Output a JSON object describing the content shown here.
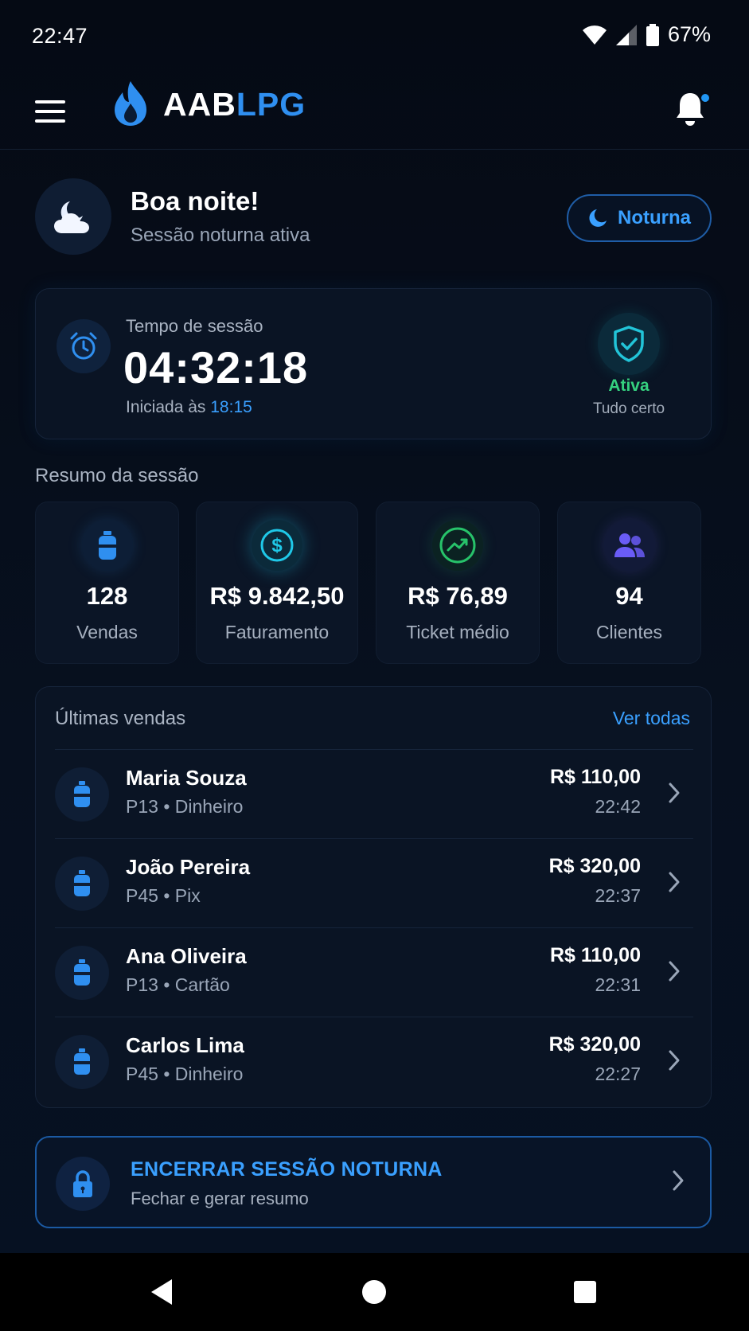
{
  "status_bar": {
    "time": "22:47",
    "battery": "67%"
  },
  "header": {
    "logo_part1": "AAB",
    "logo_part2": "LPG"
  },
  "greeting": {
    "title": "Boa noite!",
    "subtitle": "Sessão noturna ativa",
    "mode_label": "Noturna"
  },
  "session": {
    "label": "Tempo de sessão",
    "elapsed": "04:32:18",
    "started_prefix": "Iniciada às",
    "started_time": "18:15",
    "status": "Ativa",
    "status_sub": "Tudo certo"
  },
  "summary": {
    "title": "Resumo da sessão",
    "stats": [
      {
        "value": "128",
        "label": "Vendas",
        "icon": "gas-cylinder-icon",
        "color": "#2f8ff0"
      },
      {
        "value": "R$ 9.842,50",
        "label": "Faturamento",
        "icon": "dollar-icon",
        "color": "#1fc8e8"
      },
      {
        "value": "R$ 76,89",
        "label": "Ticket médio",
        "icon": "trend-up-icon",
        "color": "#27c26a"
      },
      {
        "value": "94",
        "label": "Clientes",
        "icon": "users-icon",
        "color": "#6a5cf6"
      }
    ]
  },
  "recent_sales": {
    "title": "Últimas vendas",
    "view_all": "Ver todas",
    "items": [
      {
        "name": "Maria Souza",
        "meta": "P13 • Dinheiro",
        "amount": "R$ 110,00",
        "time": "22:42"
      },
      {
        "name": "João Pereira",
        "meta": "P45 • Pix",
        "amount": "R$ 320,00",
        "time": "22:37"
      },
      {
        "name": "Ana Oliveira",
        "meta": "P13 • Cartão",
        "amount": "R$ 110,00",
        "time": "22:31"
      },
      {
        "name": "Carlos Lima",
        "meta": "P45 • Dinheiro",
        "amount": "R$ 320,00",
        "time": "22:27"
      }
    ]
  },
  "end_session": {
    "title": "ENCERRAR SESSÃO NOTURNA",
    "subtitle": "Fechar e gerar resumo"
  },
  "colors": {
    "accent": "#2f8ff0",
    "success": "#35d07f",
    "background": "#050b16"
  }
}
